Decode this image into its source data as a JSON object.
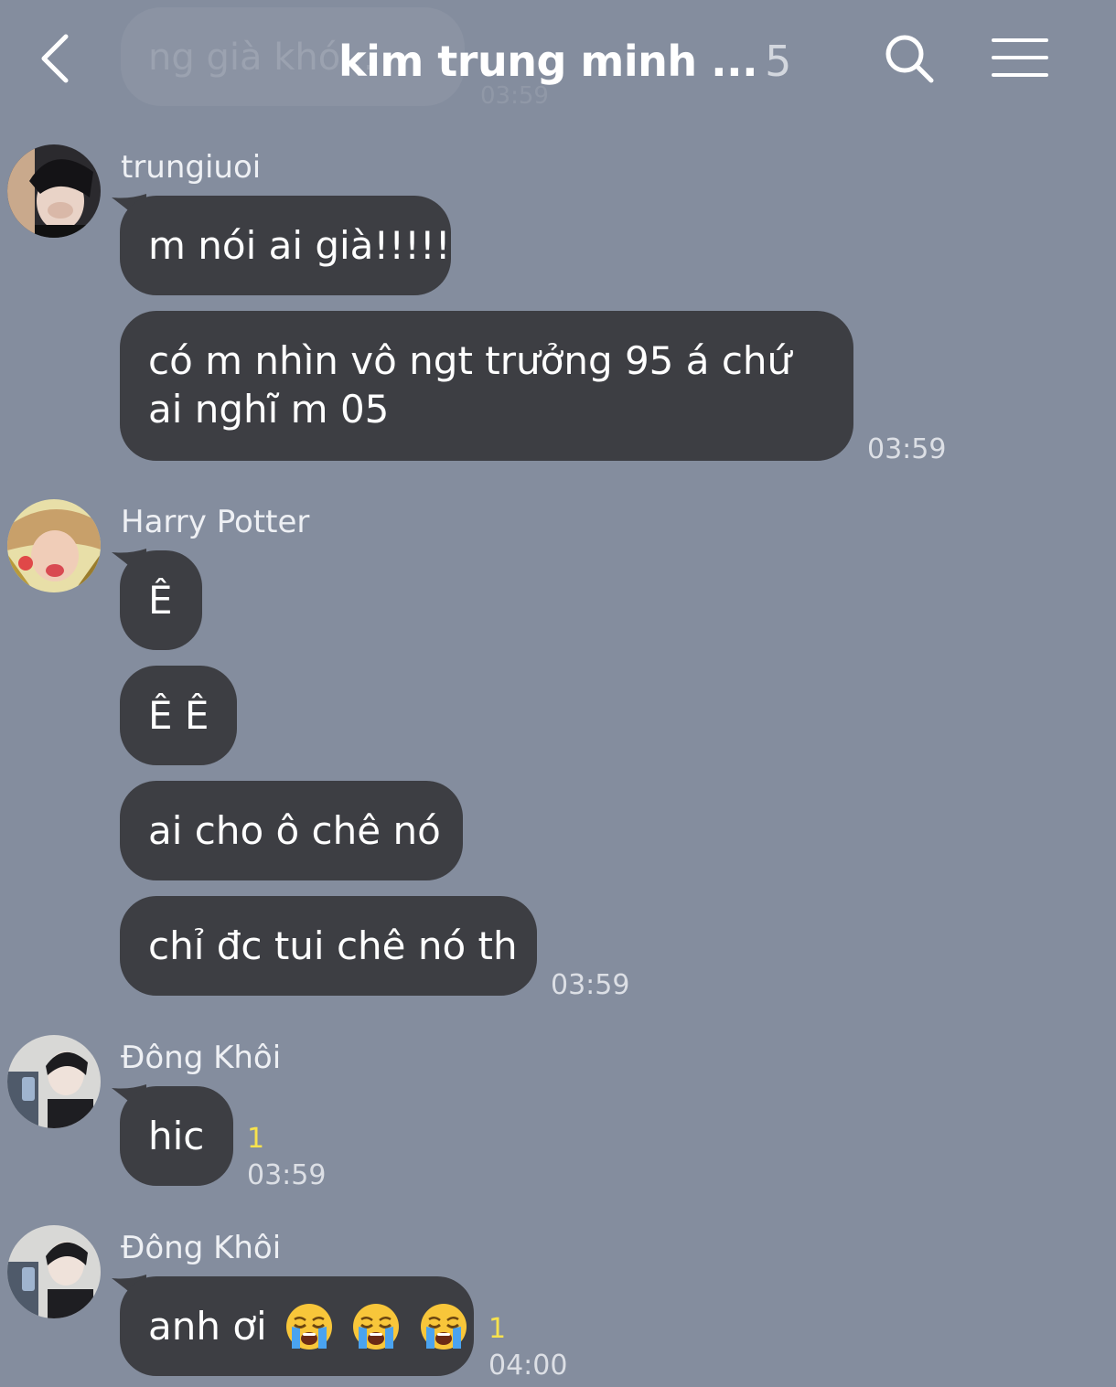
{
  "header": {
    "title": "kim trung minh ...",
    "member_count": "5",
    "background_message_text": "ng già khó...",
    "background_message_time": "03:59"
  },
  "colors": {
    "background": "#848d9e",
    "bubble": "#3d3e43",
    "unread": "#f7e24d"
  },
  "messages": [
    {
      "sender": "trungiuoi",
      "avatar": "avatar-dark-hair-icon",
      "bubbles": [
        "m nói ai già!!!!!",
        "có m nhìn vô ngt trưởng 95 á chứ ai nghĩ m 05"
      ],
      "time": "03:59"
    },
    {
      "sender": "Harry Potter",
      "avatar": "avatar-blonde-hair-icon",
      "bubbles": [
        "Ê",
        "Ê Ê",
        "ai cho ô chê nó",
        "chỉ đc tui chê nó th"
      ],
      "time": "03:59"
    },
    {
      "sender": "Đông Khôi",
      "avatar": "avatar-mirror-selfie-icon",
      "bubbles": [
        "hic"
      ],
      "unread": "1",
      "time": "03:59"
    },
    {
      "sender": "Đông Khôi",
      "avatar": "avatar-mirror-selfie-icon",
      "bubbles": [
        "anh ơi"
      ],
      "emojis": [
        "loudly-crying-face-icon",
        "loudly-crying-face-icon",
        "loudly-crying-face-icon"
      ],
      "unread": "1",
      "time": "04:00"
    }
  ]
}
